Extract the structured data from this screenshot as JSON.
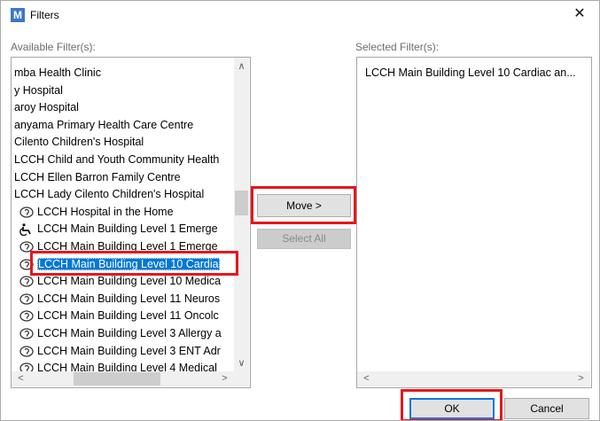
{
  "window": {
    "icon_letter": "M",
    "title": "Filters",
    "close_glyph": "✕"
  },
  "available": {
    "label": "Available Filter(s):",
    "items": [
      {
        "text": "mba Health Clinic",
        "icon": "none"
      },
      {
        "text": "y Hospital",
        "icon": "none"
      },
      {
        "text": "aroy Hospital",
        "icon": "none"
      },
      {
        "text": "anyama Primary Health Care Centre",
        "icon": "none"
      },
      {
        "text": "Cilento Children's Hospital",
        "icon": "none"
      },
      {
        "text": "LCCH Child and Youth Community Health",
        "icon": "none"
      },
      {
        "text": "LCCH Ellen Barron Family Centre",
        "icon": "none"
      },
      {
        "text": "LCCH Lady Cilento Children's Hospital",
        "icon": "none"
      },
      {
        "text": "LCCH Hospital in the Home",
        "icon": "ear-icon"
      },
      {
        "text": "LCCH Main Building Level 1 Emerge",
        "icon": "wheelchair-icon"
      },
      {
        "text": "LCCH Main Building Level 1 Emerge",
        "icon": "ear-icon"
      },
      {
        "text": "LCCH Main Building Level 10 Cardia",
        "icon": "ear-icon",
        "selected": true
      },
      {
        "text": "LCCH Main Building Level 10 Medica",
        "icon": "ear-icon"
      },
      {
        "text": "LCCH Main Building Level 11 Neuros",
        "icon": "ear-icon"
      },
      {
        "text": "LCCH Main Building Level 11 Oncolc",
        "icon": "ear-icon"
      },
      {
        "text": "LCCH Main Building Level 3 Allergy a",
        "icon": "ear-icon"
      },
      {
        "text": "LCCH Main Building Level 3 ENT Adr",
        "icon": "ear-icon"
      },
      {
        "text": "LCCH Main Building Level 4 Medical",
        "icon": "ear-icon"
      }
    ]
  },
  "selected": {
    "label": "Selected Filter(s):",
    "items": [
      {
        "text": "LCCH Main Building Level 10 Cardiac an..."
      }
    ]
  },
  "buttons": {
    "move": "Move >",
    "select_all": "Select All",
    "ok": "OK",
    "cancel": "Cancel"
  },
  "scroll": {
    "up": "∧",
    "down": "∨",
    "left": "<",
    "right": ">"
  },
  "colors": {
    "selection": "#0078d7",
    "highlight": "#e5171d"
  }
}
